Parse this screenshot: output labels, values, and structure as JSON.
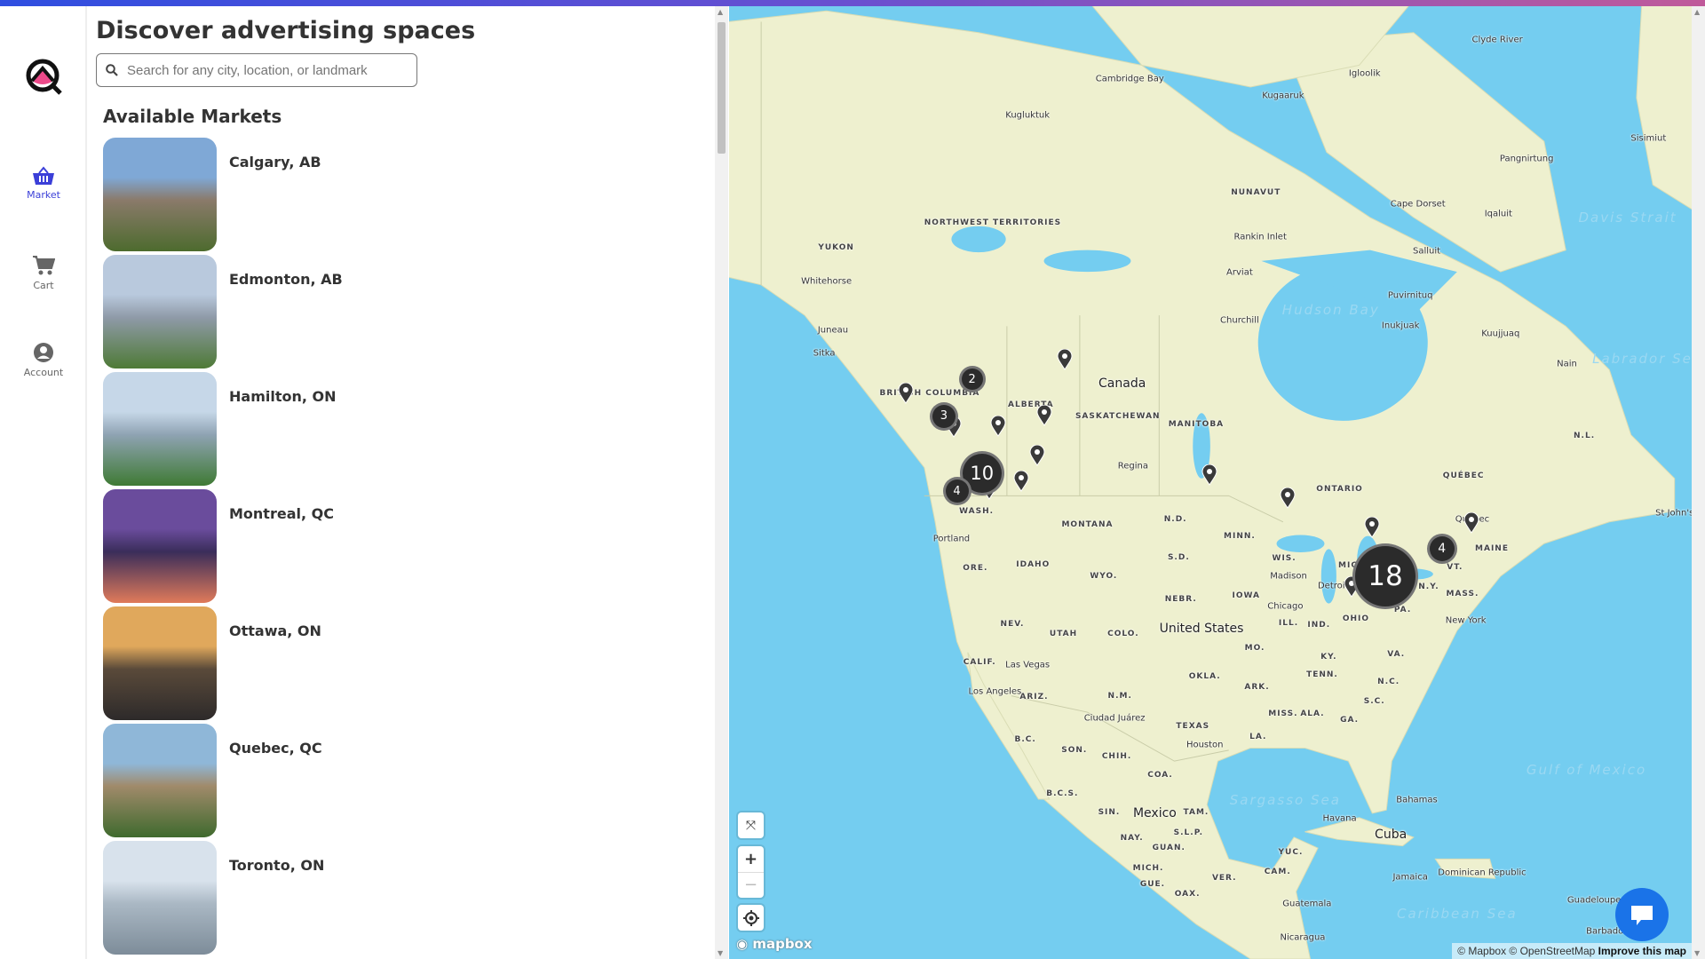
{
  "nav": {
    "items": [
      {
        "label": "Market",
        "icon": "basket-icon",
        "active": true
      },
      {
        "label": "Cart",
        "icon": "cart-icon"
      },
      {
        "label": "Account",
        "icon": "account-icon"
      }
    ]
  },
  "header": {
    "title": "Discover advertising spaces",
    "search_placeholder": "Search for any city, location, or landmark"
  },
  "markets": {
    "title": "Available Markets",
    "items": [
      {
        "name": "Calgary, AB",
        "colors": [
          "#7fa8d6",
          "#8a7a6a",
          "#4d6b2e"
        ]
      },
      {
        "name": "Edmonton, AB",
        "colors": [
          "#b9c9dd",
          "#8f9aa8",
          "#4e7a36"
        ]
      },
      {
        "name": "Hamilton, ON",
        "colors": [
          "#c6d7e8",
          "#8fa3b3",
          "#3f7a34"
        ]
      },
      {
        "name": "Montreal, QC",
        "colors": [
          "#6a4c9c",
          "#3a2d5a",
          "#e07a5a"
        ]
      },
      {
        "name": "Ottawa, ON",
        "colors": [
          "#e0a85c",
          "#5a4a3a",
          "#2d2a2a"
        ]
      },
      {
        "name": "Quebec, QC",
        "colors": [
          "#8fb7d8",
          "#a08a6a",
          "#3f6a2e"
        ]
      },
      {
        "name": "Toronto, ON",
        "colors": [
          "#d8e2ec",
          "#aab8c4",
          "#7d8c99"
        ]
      }
    ]
  },
  "map": {
    "colors": {
      "water": "#74cdf0",
      "land": "#eef0cf",
      "cluster": "#2b2b2b"
    },
    "clusters": [
      "2",
      "3",
      "10",
      "4",
      "18",
      "4"
    ],
    "labels": [
      "Canada",
      "United States",
      "Mexico",
      "Cuba",
      "Hudson Bay",
      "NUNAVUT",
      "NORTHWEST TERRITORIES",
      "YUKON",
      "BRITISH COLUMBIA",
      "ALBERTA",
      "SASKATCHEWAN",
      "MANITOBA",
      "ONTARIO",
      "QUÉBEC",
      "N.L.",
      "MONTANA",
      "WASH.",
      "ORE.",
      "IDAHO",
      "WYO.",
      "NEV.",
      "UTAH",
      "COLO.",
      "CALIF.",
      "ARIZ.",
      "N.M.",
      "TEXAS",
      "OKLA.",
      "N.D.",
      "S.D.",
      "NEBR.",
      "MINN.",
      "IOWA",
      "WIS.",
      "ILL.",
      "MICH.",
      "IND.",
      "OHIO",
      "PA.",
      "N.Y.",
      "VT.",
      "MAINE",
      "MASS.",
      "KY.",
      "TENN.",
      "VA.",
      "N.C.",
      "S.C.",
      "GA.",
      "ALA.",
      "MISS.",
      "LA.",
      "ARK.",
      "MO.",
      "Portland",
      "Las Vegas",
      "Los Angeles",
      "Chicago",
      "New York",
      "Detroit",
      "Houston",
      "Ciudad Juárez",
      "Regina",
      "Whitehorse",
      "Churchill",
      "Arviat",
      "Rankin Inlet",
      "Iqaluit",
      "Kuujjuaq",
      "Cambridge Bay",
      "Kugluktuk",
      "Igloolik",
      "Havana",
      "Bahamas",
      "Jamaica",
      "Dominican Republic",
      "Guatemala",
      "Nicaragua",
      "Caribbean Sea",
      "Gulf of Mexico",
      "Sargasso Sea",
      "Labrador Sea",
      "Davis Strait",
      "Juneau",
      "Sitka",
      "Madison",
      "Quebec",
      "St John's",
      "Pangnirtung",
      "Nain",
      "Clyde River",
      "Kugaaruk",
      "Cape Dorset",
      "Salluit",
      "Puvirnituq",
      "Inukjuak",
      "Sisimiut",
      "B.C.S.",
      "SON.",
      "CHIH.",
      "COA.",
      "SIN.",
      "TAM.",
      "S.L.P.",
      "NAY.",
      "GUAN.",
      "MICH.",
      "VER.",
      "GUE.",
      "OAX.",
      "YUC.",
      "CAM.",
      "B.C.",
      "Guadeloupe",
      "Barbados"
    ],
    "brand": "mapbox",
    "attribution": "© Mapbox © OpenStreetMap",
    "improve": "Improve this map"
  }
}
